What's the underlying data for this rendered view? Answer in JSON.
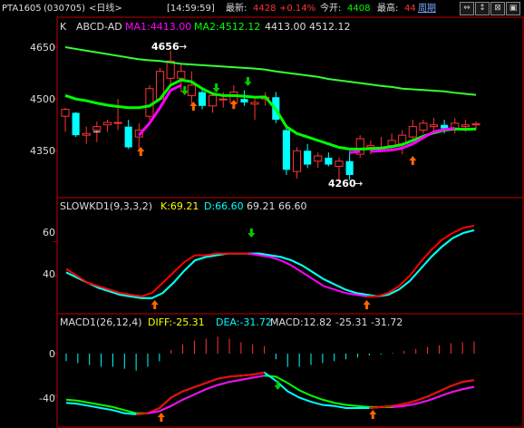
{
  "topbar": {
    "symbol": "PTA1605",
    "code": "(030705)",
    "period": "<日线>",
    "time": "[14:59:59]",
    "latest_label": "最新:",
    "latest_value": "4428",
    "change_pct": "+0.14%",
    "open_label": "今开:",
    "open_value": "4408",
    "high_label": "最高:",
    "high_value": "44",
    "cycle_link": "周期",
    "nav_buttons": [
      "⇔",
      "↕",
      "⊠",
      "▣"
    ]
  },
  "panel_kline": {
    "prefix": "K",
    "indicator": "ABCD-AD",
    "ma1_label": "MA1:4413.00",
    "ma2_label": "MA2:4512.12",
    "extra_values": "4413.00 4512.12",
    "y_ticks": [
      "4650",
      "4500",
      "4350"
    ],
    "annotations": [
      "4656",
      "4260"
    ],
    "colors": {
      "ma1": "#ff00ff",
      "ma2": "#00ff00",
      "up": "#ff3333",
      "down": "#00ffff",
      "signal_up": "#ff6600",
      "signal_down": "#00cc00"
    }
  },
  "panel_kd": {
    "title": "SLOWKD1(9,3,3,2)",
    "k_label": "K:69.21",
    "d_label": "D:66.60",
    "extra_values": "69.21 66.60",
    "y_ticks": [
      "60",
      "40"
    ],
    "colors": {
      "k": "#ff0000",
      "k_alt": "#ff00ff",
      "d": "#00ffff",
      "d_alt": "#00ff00"
    }
  },
  "panel_macd": {
    "title": "MACD1(26,12,4)",
    "diff_label": "DIFF:-25.31",
    "dea_label": "DEA:-31.72",
    "macd_label": "MACD:12.82",
    "extra_values": "-25.31 -31.72",
    "y_ticks": [
      "0",
      "-40"
    ],
    "colors": {
      "hist_pos": "#ff3333",
      "hist_neg": "#00ffff",
      "diff": "#ff0000",
      "dea": "#ff00ff"
    }
  },
  "chart_data": {
    "type": "candlestick",
    "y_ticks_price": [
      "4650",
      "4500",
      "4350"
    ],
    "price_annotations": [
      {
        "label": "4656",
        "role": "period high"
      },
      {
        "label": "4260",
        "role": "period low"
      }
    ],
    "candles": [
      {
        "o": 4450,
        "h": 4475,
        "l": 4405,
        "c": 4470
      },
      {
        "o": 4460,
        "h": 4462,
        "l": 4390,
        "c": 4395
      },
      {
        "o": 4395,
        "h": 4420,
        "l": 4370,
        "c": 4400
      },
      {
        "o": 4410,
        "h": 4435,
        "l": 4375,
        "c": 4420
      },
      {
        "o": 4425,
        "h": 4440,
        "l": 4405,
        "c": 4432
      },
      {
        "o": 4430,
        "h": 4500,
        "l": 4410,
        "c": 4432
      },
      {
        "o": 4420,
        "h": 4440,
        "l": 4355,
        "c": 4360
      },
      {
        "o": 4390,
        "h": 4430,
        "l": 4350,
        "c": 4410
      },
      {
        "o": 4450,
        "h": 4540,
        "l": 4440,
        "c": 4530
      },
      {
        "o": 4500,
        "h": 4590,
        "l": 4495,
        "c": 4580
      },
      {
        "o": 4560,
        "h": 4640,
        "l": 4540,
        "c": 4610
      },
      {
        "o": 4560,
        "h": 4600,
        "l": 4520,
        "c": 4580
      },
      {
        "o": 4510,
        "h": 4580,
        "l": 4480,
        "c": 4540
      },
      {
        "o": 4520,
        "h": 4530,
        "l": 4470,
        "c": 4480
      },
      {
        "o": 4480,
        "h": 4520,
        "l": 4460,
        "c": 4510
      },
      {
        "o": 4500,
        "h": 4520,
        "l": 4475,
        "c": 4500
      },
      {
        "o": 4490,
        "h": 4540,
        "l": 4470,
        "c": 4520
      },
      {
        "o": 4500,
        "h": 4525,
        "l": 4480,
        "c": 4490
      },
      {
        "o": 4485,
        "h": 4500,
        "l": 4440,
        "c": 4490
      },
      {
        "o": 4500,
        "h": 4520,
        "l": 4480,
        "c": 4505
      },
      {
        "o": 4505,
        "h": 4520,
        "l": 4430,
        "c": 4440
      },
      {
        "o": 4410,
        "h": 4420,
        "l": 4280,
        "c": 4295
      },
      {
        "o": 4290,
        "h": 4360,
        "l": 4270,
        "c": 4350
      },
      {
        "o": 4350,
        "h": 4370,
        "l": 4300,
        "c": 4310
      },
      {
        "o": 4320,
        "h": 4345,
        "l": 4300,
        "c": 4335
      },
      {
        "o": 4330,
        "h": 4345,
        "l": 4305,
        "c": 4310
      },
      {
        "o": 4305,
        "h": 4330,
        "l": 4260,
        "c": 4320
      },
      {
        "o": 4320,
        "h": 4350,
        "l": 4265,
        "c": 4280
      },
      {
        "o": 4340,
        "h": 4395,
        "l": 4330,
        "c": 4385
      },
      {
        "o": 4360,
        "h": 4380,
        "l": 4340,
        "c": 4365
      },
      {
        "o": 4355,
        "h": 4390,
        "l": 4345,
        "c": 4360
      },
      {
        "o": 4365,
        "h": 4400,
        "l": 4350,
        "c": 4380
      },
      {
        "o": 4370,
        "h": 4410,
        "l": 4340,
        "c": 4395
      },
      {
        "o": 4390,
        "h": 4440,
        "l": 4380,
        "c": 4420
      },
      {
        "o": 4410,
        "h": 4440,
        "l": 4400,
        "c": 4430
      },
      {
        "o": 4420,
        "h": 4445,
        "l": 4405,
        "c": 4425
      },
      {
        "o": 4425,
        "h": 4440,
        "l": 4400,
        "c": 4415
      },
      {
        "o": 4415,
        "h": 4445,
        "l": 4400,
        "c": 4430
      },
      {
        "o": 4420,
        "h": 4440,
        "l": 4405,
        "c": 4425
      },
      {
        "o": 4425,
        "h": 4435,
        "l": 4410,
        "c": 4428
      }
    ],
    "ma1": [
      4445,
      4435,
      4425,
      4418,
      4413,
      4410,
      4405,
      4395,
      4430,
      4475,
      4525,
      4540,
      4538,
      4530,
      4518,
      4508,
      4505,
      4502,
      4498,
      4496,
      4465,
      4410,
      4390,
      4380,
      4372,
      4362,
      4350,
      4345,
      4348,
      4348,
      4350,
      4352,
      4358,
      4370,
      4388,
      4405,
      4412,
      4415,
      4413,
      4413
    ],
    "ma2": [
      4510,
      4500,
      4495,
      4488,
      4482,
      4478,
      4475,
      4475,
      4480,
      4500,
      4540,
      4555,
      4550,
      4530,
      4515,
      4510,
      4510,
      4508,
      4505,
      4506,
      4470,
      4420,
      4400,
      4390,
      4380,
      4370,
      4360,
      4355,
      4355,
      4356,
      4358,
      4362,
      4368,
      4380,
      4392,
      4402,
      4410,
      4413,
      4412,
      4413
    ],
    "ma_long": [
      4650,
      4645,
      4640,
      4635,
      4630,
      4625,
      4620,
      4615,
      4612,
      4610,
      4606,
      4602,
      4600,
      4598,
      4596,
      4594,
      4592,
      4590,
      4588,
      4585,
      4580,
      4576,
      4572,
      4568,
      4564,
      4558,
      4554,
      4550,
      4546,
      4542,
      4538,
      4535,
      4530,
      4528,
      4526,
      4524,
      4522,
      4518,
      4515,
      4512
    ],
    "kd": {
      "y_ticks": [
        "60",
        "40"
      ],
      "k": [
        44,
        40,
        36,
        34,
        32,
        30,
        29,
        28,
        30,
        36,
        42,
        48,
        52,
        52,
        53,
        53,
        53,
        53,
        52,
        51,
        49,
        46,
        42,
        38,
        34,
        32,
        30,
        29,
        28,
        28,
        30,
        34,
        40,
        48,
        55,
        61,
        65,
        68,
        69.21
      ],
      "d": [
        42,
        39,
        36,
        33,
        31,
        29,
        28,
        27,
        27,
        30,
        36,
        43,
        49,
        51,
        52,
        53,
        53,
        53,
        53,
        52,
        51,
        49,
        46,
        42,
        38,
        35,
        32,
        30,
        29,
        28,
        29,
        32,
        37,
        44,
        51,
        57,
        62,
        65,
        66.6
      ]
    },
    "macd": {
      "y_ticks": [
        "0",
        "-40"
      ],
      "diff": [
        -47,
        -48,
        -50,
        -52,
        -54,
        -57,
        -58,
        -57,
        -52,
        -42,
        -36,
        -32,
        -28,
        -24,
        -22,
        -21,
        -20,
        -18,
        -26,
        -36,
        -42,
        -46,
        -49,
        -50,
        -52,
        -52,
        -52,
        -51,
        -50,
        -48,
        -45,
        -41,
        -36,
        -31,
        -27,
        -25.31
      ],
      "dea": [
        -44,
        -45,
        -47,
        -49,
        -51,
        -54,
        -57,
        -57,
        -55,
        -50,
        -44,
        -39,
        -34,
        -30,
        -27,
        -25,
        -23,
        -21,
        -22,
        -28,
        -35,
        -40,
        -44,
        -47,
        -49,
        -50,
        -51,
        -51,
        -51,
        -50,
        -48,
        -45,
        -41,
        -37,
        -34,
        -31.72
      ],
      "hist": [
        -8,
        -10,
        -12,
        -14,
        -14,
        -16,
        -18,
        -14,
        -8,
        4,
        10,
        14,
        16,
        18,
        16,
        12,
        10,
        8,
        -6,
        -14,
        -14,
        -12,
        -10,
        -8,
        -6,
        -4,
        -2,
        -1,
        1,
        3,
        5,
        7,
        9,
        11,
        12,
        12.82
      ]
    }
  }
}
